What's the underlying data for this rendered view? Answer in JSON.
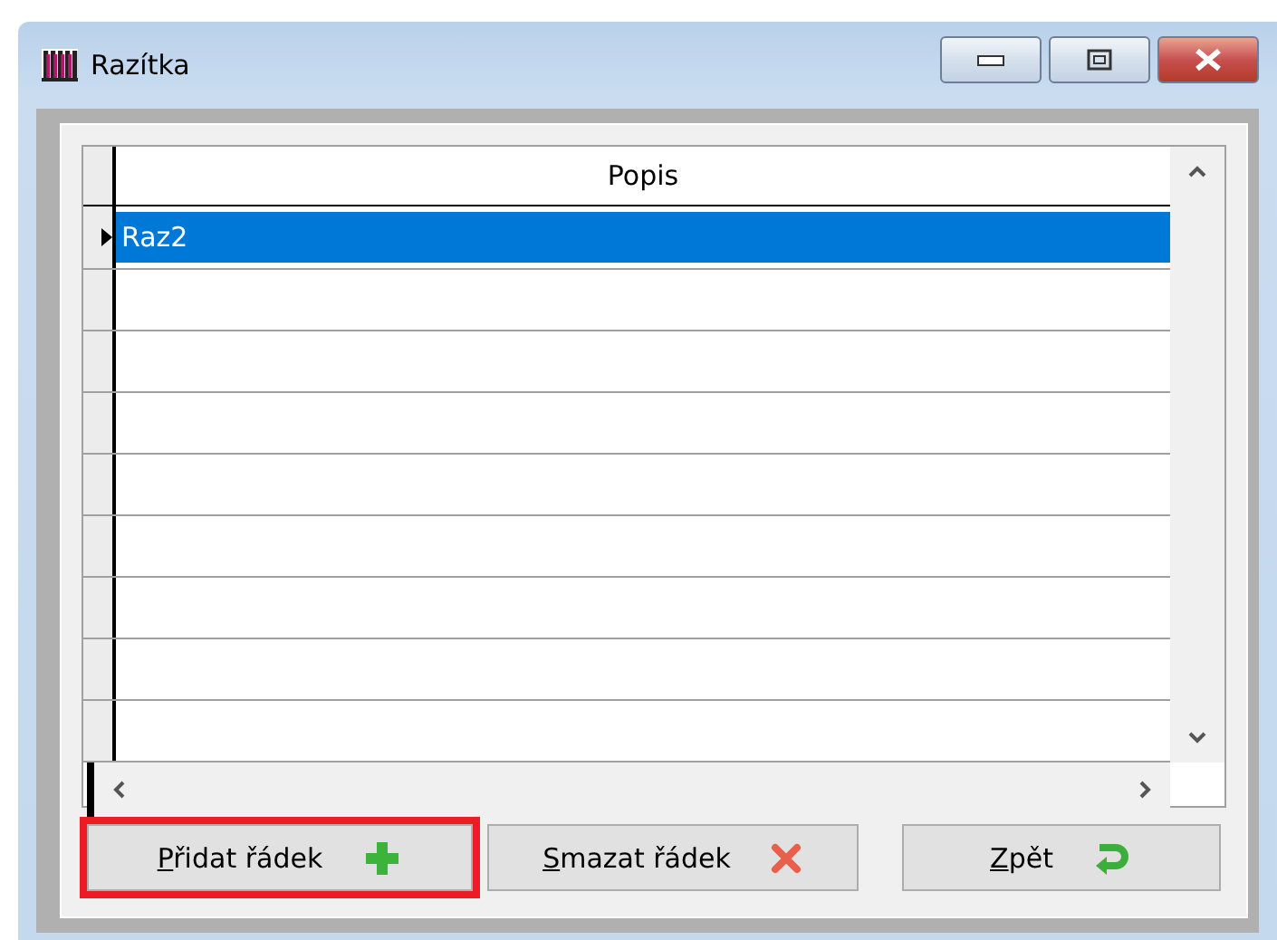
{
  "window": {
    "title": "Razítka"
  },
  "table": {
    "columns": [
      "Popis"
    ],
    "rows": [
      {
        "cells": [
          "Raz2"
        ],
        "selected": true
      }
    ]
  },
  "buttons": [
    {
      "label": "Přidat řádek",
      "highlighted": true
    },
    {
      "label": "Smazat řádek",
      "highlighted": false
    },
    {
      "label": "Zpět",
      "highlighted": false
    }
  ]
}
